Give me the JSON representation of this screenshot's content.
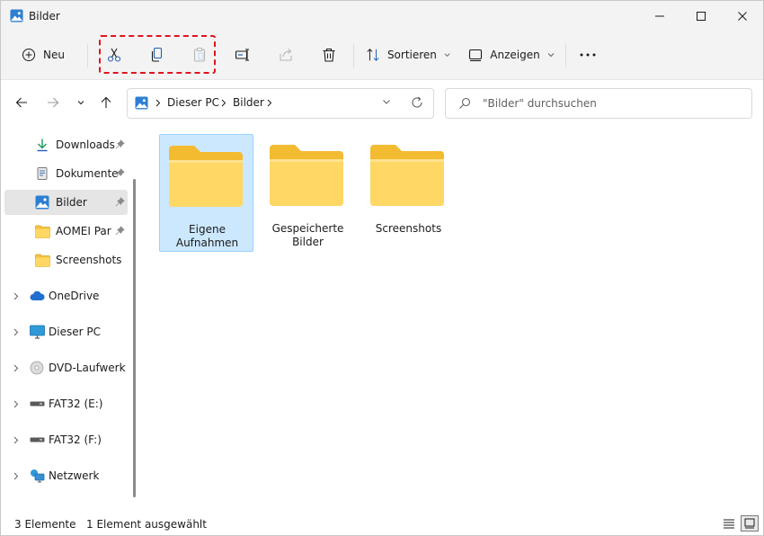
{
  "window": {
    "title": "Bilder"
  },
  "toolbar": {
    "new_label": "Neu",
    "sort_label": "Sortieren",
    "view_label": "Anzeigen",
    "icons": [
      "plus-circle-icon",
      "scissors-icon",
      "copy-icon",
      "paste-icon",
      "rename-icon",
      "share-icon",
      "trash-icon",
      "sort-icon",
      "view-icon",
      "more-icon"
    ]
  },
  "address": {
    "crumbs": [
      "Dieser PC",
      "Bilder"
    ]
  },
  "search": {
    "placeholder": "\"Bilder\" durchsuchen"
  },
  "sidebar": {
    "quick_access": [
      {
        "label": "Downloads",
        "icon": "download-icon",
        "pinned": true
      },
      {
        "label": "Dokumente",
        "icon": "document-icon",
        "pinned": true
      },
      {
        "label": "Bilder",
        "icon": "pictures-icon",
        "pinned": true,
        "selected": true
      },
      {
        "label": "AOMEI Parti",
        "icon": "folder-icon",
        "pinned": true
      },
      {
        "label": "Screenshots",
        "icon": "folder-icon",
        "pinned": false
      }
    ],
    "tree": [
      {
        "label": "OneDrive",
        "icon": "cloud-icon"
      },
      {
        "label": "Dieser PC",
        "icon": "monitor-icon"
      },
      {
        "label": "DVD-Laufwerk (D",
        "icon": "disc-icon"
      },
      {
        "label": "FAT32 (E:)",
        "icon": "drive-icon"
      },
      {
        "label": "FAT32 (F:)",
        "icon": "drive-icon"
      },
      {
        "label": "Netzwerk",
        "icon": "network-icon"
      }
    ]
  },
  "content": {
    "items": [
      {
        "label": "Eigene Aufnahmen",
        "selected": true
      },
      {
        "label": "Gespeicherte Bilder",
        "selected": false
      },
      {
        "label": "Screenshots",
        "selected": false
      }
    ]
  },
  "status": {
    "count": "3 Elemente",
    "selection": "1 Element ausgewählt"
  },
  "colors": {
    "selection_bg": "#cce8ff",
    "highlight_border": "#e0141e",
    "folder_yellow": "#ffd04a"
  }
}
